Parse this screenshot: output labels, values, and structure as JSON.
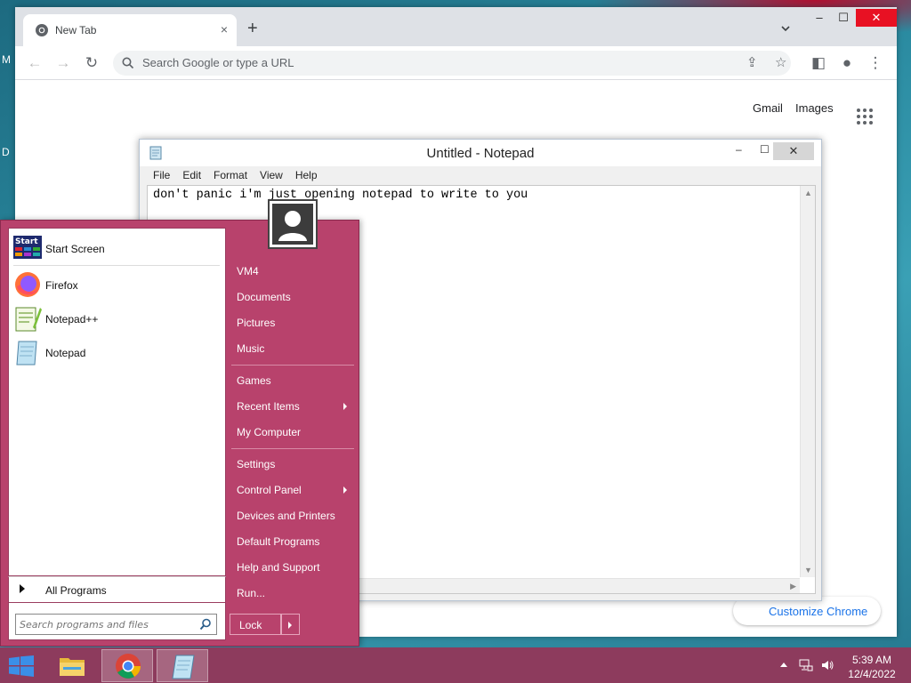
{
  "desktop": {
    "glyph_top": "M",
    "glyph_mid": "D"
  },
  "chrome": {
    "tab_title": "New Tab",
    "tab_close": "×",
    "new_tab": "+",
    "omnibox_placeholder": "Search Google or type a URL",
    "links": {
      "gmail": "Gmail",
      "images": "Images"
    },
    "customize_label": "Customize Chrome",
    "window_controls": {
      "minimize": "–",
      "maximize": "☐",
      "close": "✕"
    }
  },
  "notepad": {
    "title": "Untitled - Notepad",
    "menu": [
      "File",
      "Edit",
      "Format",
      "View",
      "Help"
    ],
    "text": "don't panic i'm just opening notepad to write to you",
    "controls": {
      "minimize": "–",
      "maximize": "☐",
      "close": "✕"
    }
  },
  "start_menu": {
    "pinned": [
      {
        "label": "Start Screen",
        "icon": "start-screen-icon"
      },
      {
        "label": "Firefox",
        "icon": "firefox-icon"
      },
      {
        "label": "Notepad++",
        "icon": "notepadpp-icon"
      },
      {
        "label": "Notepad",
        "icon": "notepad-icon"
      }
    ],
    "all_programs": "All Programs",
    "search_placeholder": "Search programs and files",
    "right_items": [
      {
        "label": "VM4"
      },
      {
        "label": "Documents"
      },
      {
        "label": "Pictures"
      },
      {
        "label": "Music"
      },
      {
        "label": "Games"
      },
      {
        "label": "Recent Items",
        "submenu": true
      },
      {
        "label": "My Computer"
      },
      {
        "label": "Settings"
      },
      {
        "label": "Control Panel",
        "submenu": true
      },
      {
        "label": "Devices and Printers"
      },
      {
        "label": "Default Programs"
      },
      {
        "label": "Help and Support"
      },
      {
        "label": "Run..."
      }
    ],
    "lock_label": "Lock"
  },
  "taskbar": {
    "apps": [
      {
        "name": "file-explorer",
        "icon": "folder-icon"
      },
      {
        "name": "chrome",
        "icon": "chrome-icon"
      },
      {
        "name": "notepad",
        "icon": "notepad-icon"
      }
    ],
    "clock": {
      "time": "5:39 AM",
      "date": "12/4/2022"
    }
  },
  "colors": {
    "start_menu_bg": "#b8426c",
    "taskbar_bg": "#8d3b5d",
    "chrome_accent": "#1a73e8"
  }
}
